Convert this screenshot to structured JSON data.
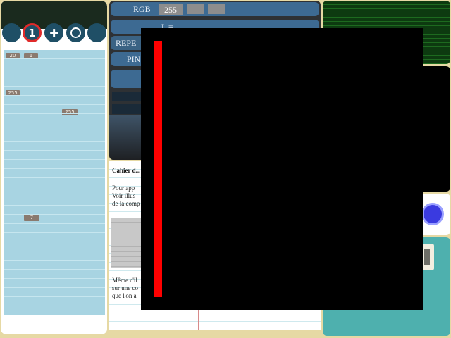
{
  "toolbar": {
    "buttons": [
      {
        "name": "tool-1",
        "label": ""
      },
      {
        "name": "tool-number",
        "label": "1"
      },
      {
        "name": "tool-add",
        "label": "✚"
      },
      {
        "name": "tool-ring",
        "label": ""
      },
      {
        "name": "tool-5",
        "label": ""
      }
    ],
    "active_index": 1
  },
  "grid": {
    "badges": [
      "20",
      "1",
      "255",
      "255",
      "7"
    ]
  },
  "color_panel": {
    "rgb_label": "RGB",
    "rgb_value": "255",
    "l_label": "L =",
    "repeat_label": "REPE",
    "pin_label": "PIN"
  },
  "document": {
    "title": "Cahier d...",
    "lines": [
      "Pour   app",
      "Voir illus",
      "de la comp"
    ],
    "lines_bottom": [
      "Même c'il",
      "sur une co",
      "que l'on a"
    ]
  },
  "colors": {
    "accent": "#3d6a92",
    "active_ring": "#e02a2a",
    "overlay": "#000000",
    "overlay_bar": "#ff0000"
  },
  "icons": {
    "knob": "blue-knob-icon",
    "pause": "pause-icon"
  }
}
